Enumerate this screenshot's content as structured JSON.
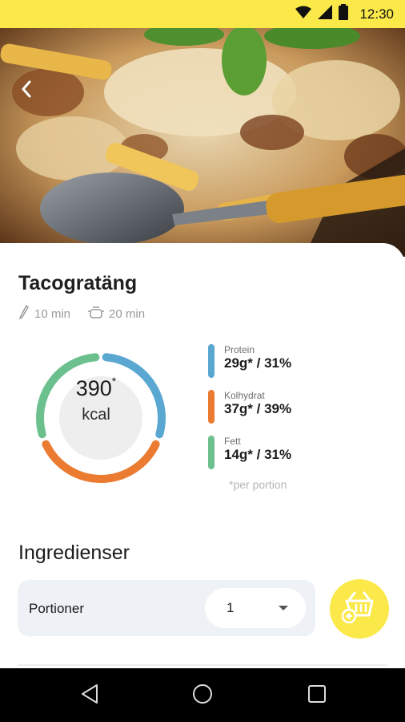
{
  "status_bar": {
    "time": "12:30",
    "icons": [
      "wifi-icon",
      "signal-icon",
      "battery-icon"
    ],
    "background": "#fbe94a"
  },
  "hero": {
    "image": "pasta-bake-photo",
    "back_icon": "chevron-left-icon"
  },
  "recipe": {
    "title": "Tacogratäng",
    "prep_time": "10 min",
    "cook_time": "20 min",
    "prep_icon": "knife-icon",
    "cook_icon": "pot-icon"
  },
  "nutrition": {
    "kcal_value": "390",
    "kcal_marker": "*",
    "kcal_unit": "kcal",
    "macros": [
      {
        "label": "Protein",
        "value": "29g* / 31%",
        "color": "#5aa8d1",
        "percent": 31
      },
      {
        "label": "Kolhydrat",
        "value": "37g* / 39%",
        "color": "#ea7b30",
        "percent": 39
      },
      {
        "label": "Fett",
        "value": "14g* / 31%",
        "color": "#6cc08e",
        "percent": 31
      }
    ],
    "footnote": "*per portion"
  },
  "ingredients": {
    "title": "Ingredienser",
    "portions_label": "Portioner",
    "portions_value": "1",
    "basket_icon": "add-to-basket-icon"
  },
  "colors": {
    "accent_yellow": "#fbe94a",
    "protein": "#5aa8d1",
    "carbs": "#ea7b30",
    "fat": "#6cc08e"
  },
  "nav_bar": {
    "buttons": [
      "back-triangle-icon",
      "home-circle-icon",
      "recents-square-icon"
    ]
  }
}
